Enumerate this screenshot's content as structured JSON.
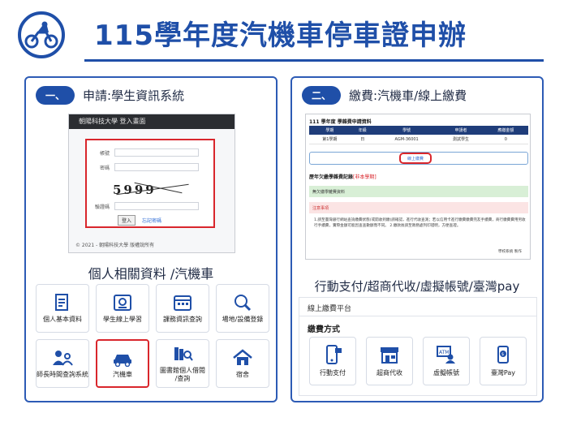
{
  "header": {
    "title": "115學年度汽機車停車證申辦",
    "logo_icon": "motorcycle-rider-icon"
  },
  "left_panel": {
    "step_badge": "一、",
    "step_title": "申請:學生資訊系統",
    "login_screenshot": {
      "window_title": "朝陽科技大學 登入畫面",
      "account_label": "帳號",
      "password_label": "密碼",
      "captcha_text": "5999",
      "captcha_label": "驗證碼",
      "login_button": "登入",
      "forgot_link": "忘記密碼",
      "footer": "© 2021 - 朝陽科技大學 版權說所有"
    },
    "section_title": "個人相關資料 /汽機車",
    "tiles": [
      {
        "label": "個人基本資料",
        "icon": "profile-document-icon"
      },
      {
        "label": "學生線上學習",
        "icon": "online-learning-icon"
      },
      {
        "label": "課務資訊查詢",
        "icon": "calendar-icon"
      },
      {
        "label": "場地/設備登錄",
        "icon": "magnifier-icon"
      },
      {
        "label": "師長時間查詢系統",
        "icon": "teacher-student-icon"
      },
      {
        "label": "汽機車",
        "icon": "car-icon",
        "highlighted": true
      },
      {
        "label": "圖書館個人借閱\n/查詢",
        "icon": "library-books-icon"
      },
      {
        "label": "宿舍",
        "icon": "dormitory-house-icon"
      }
    ]
  },
  "right_panel": {
    "step_badge": "二、",
    "step_title": "繳費:汽機車/線上繳費",
    "payment_screenshot": {
      "heading": "111 學年度 學雜費申請資料",
      "columns": [
        "學期",
        "年級",
        "學號",
        "申請者",
        "應繳金額"
      ],
      "row": [
        "第1學期",
        "日",
        "AGM-36001",
        "測試學生",
        "0"
      ],
      "pay_button": "線上繳費",
      "history_title": "歷年欠繳學雜費記錄",
      "history_note": "[非本學期]",
      "no_debt": "無欠繳學雜費資料",
      "notice_title": "注意事項",
      "notes": "1.請至臺灣銀行網站查詢繳費狀態(或開收到繳)請確認，進行代收查測；若以信用卡進行繳費繳費完友手續費，商行繳費費用另收行手續費，實際金額可能因查查數額而不同。 2.繳款後請至教務處列印證明，方便查證。",
      "signature": "學校系統 製作"
    },
    "section_title": "行動支付/超商代收/虛擬帳號/臺灣pay",
    "platform_title": "線上繳費平台",
    "method_title": "繳費方式",
    "methods": [
      {
        "label": "行動支付",
        "icon": "mobile-payment-icon"
      },
      {
        "label": "超商代收",
        "icon": "convenience-store-icon"
      },
      {
        "label": "虛擬帳號",
        "icon": "atm-virtual-account-icon"
      },
      {
        "label": "臺灣Pay",
        "icon": "taiwan-pay-icon"
      }
    ]
  },
  "colors": {
    "brand_blue": "#1f4fa8",
    "highlight_red": "#d9262c"
  }
}
